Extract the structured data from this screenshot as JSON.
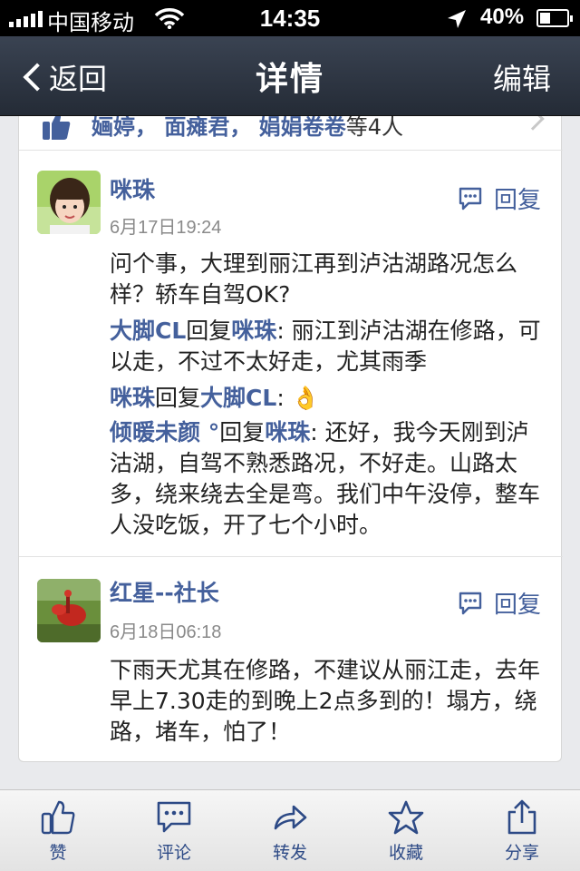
{
  "status_bar": {
    "carrier": "中国移动",
    "time": "14:35",
    "battery": "40%",
    "battery_level": 0.4
  },
  "nav": {
    "back_label": "返回",
    "title": "详情",
    "edit_label": "编辑"
  },
  "likes": {
    "names_text": "婳婷，  面瘫君，  娟娟卷卷",
    "suffix": "等4人"
  },
  "comments": [
    {
      "user": "咪珠",
      "time": "6月17日19:24",
      "reply_label": "回复",
      "text": "问个事，大理到丽江再到泸沽湖路况怎么样？轿车自驾OK?",
      "replies": [
        {
          "from": "大脚CL",
          "verb": "回复",
          "to": "咪珠",
          "text": ": 丽江到泸沽湖在修路，可以走，不过不太好走，尤其雨季"
        },
        {
          "from": "咪珠",
          "verb": "回复",
          "to": "大脚CL",
          "text": ": 👌"
        },
        {
          "from": "倾暖未颜 °",
          "verb": "回复",
          "to": "咪珠",
          "text": ": 还好，我今天刚到泸沽湖，自驾不熟悉路况，不好走。山路太多，绕来绕去全是弯。我们中午没停，整车人没吃饭，开了七个小时。"
        }
      ]
    },
    {
      "user": "红星--社长",
      "time": "6月18日06:18",
      "reply_label": "回复",
      "text": "下雨天尤其在修路，不建议从丽江走，去年早上7.30走的到晚上2点多到的！塌方，绕路，堵车，怕了！"
    }
  ],
  "tabbar": [
    {
      "label": "赞",
      "icon": "thumbs-up-icon"
    },
    {
      "label": "评论",
      "icon": "comment-icon"
    },
    {
      "label": "转发",
      "icon": "forward-icon"
    },
    {
      "label": "收藏",
      "icon": "star-icon"
    },
    {
      "label": "分享",
      "icon": "share-icon"
    }
  ],
  "colors": {
    "nav_bg": "#2b323e",
    "link_blue": "#44609c",
    "tab_blue": "#2d4a86"
  }
}
